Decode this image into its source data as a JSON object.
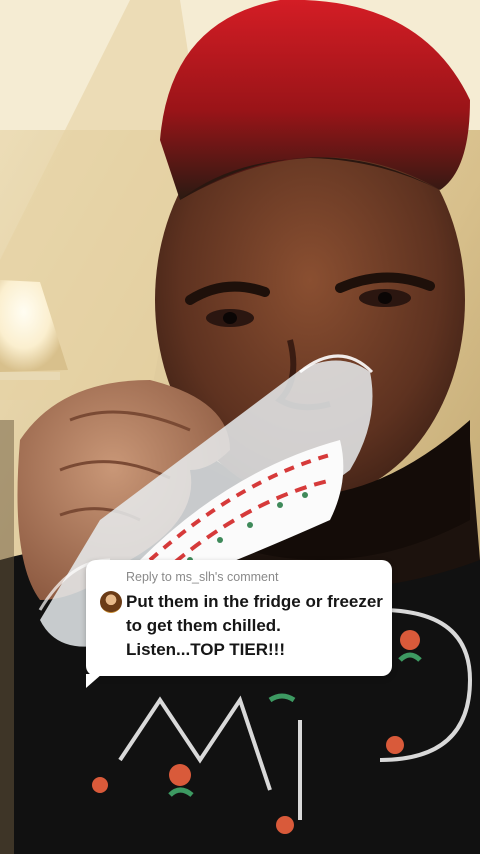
{
  "reply_sticker": {
    "header": "Reply to ms_slh's comment",
    "comment_text": "Put them in the fridge or freezer to get them chilled. Listen...TOP TIER!!!",
    "avatar_icon": "commenter-avatar-icon"
  },
  "colors": {
    "sticker_bg": "#ffffff",
    "header_text": "#8a8a8a",
    "comment_text": "#161616"
  }
}
